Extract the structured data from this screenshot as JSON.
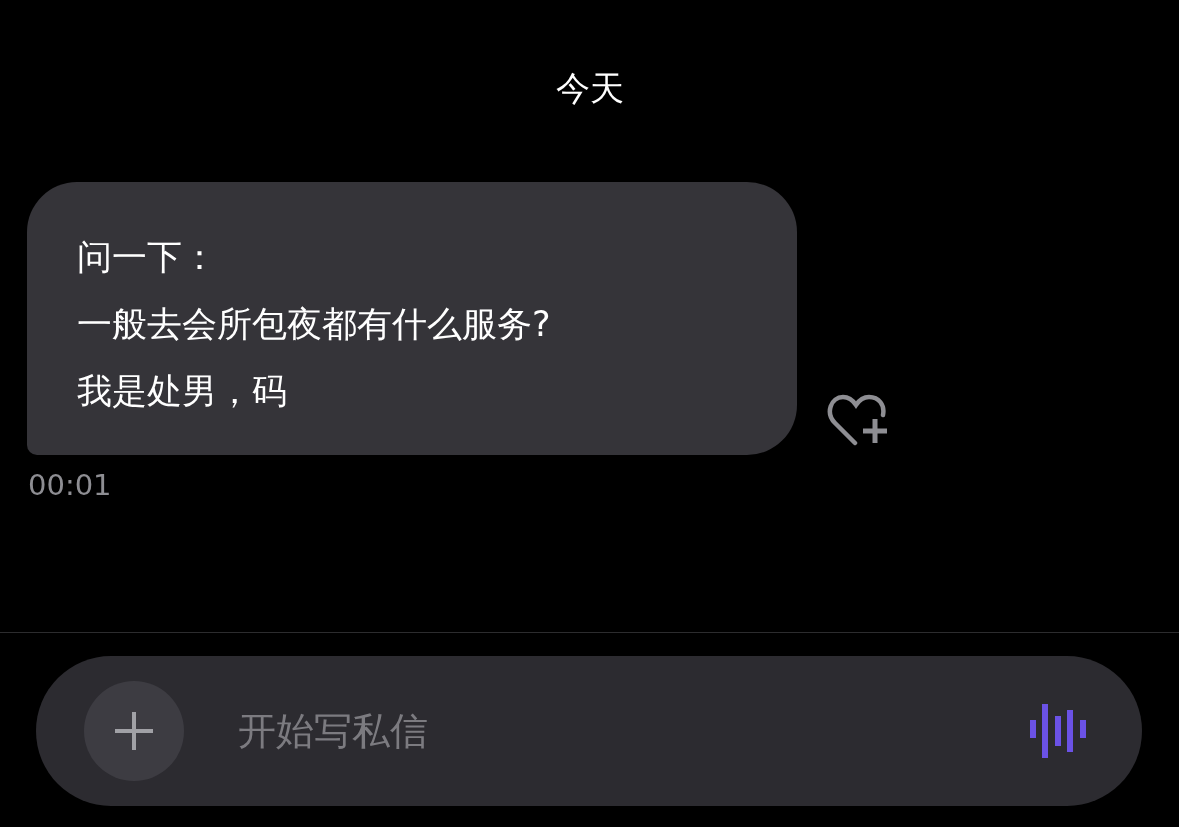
{
  "date_header": "今天",
  "message": {
    "lines": [
      "问一下：",
      "一般去会所包夜都有什么服务?",
      "我是处男，码"
    ],
    "time": "00:01"
  },
  "composer": {
    "placeholder": "开始写私信"
  }
}
